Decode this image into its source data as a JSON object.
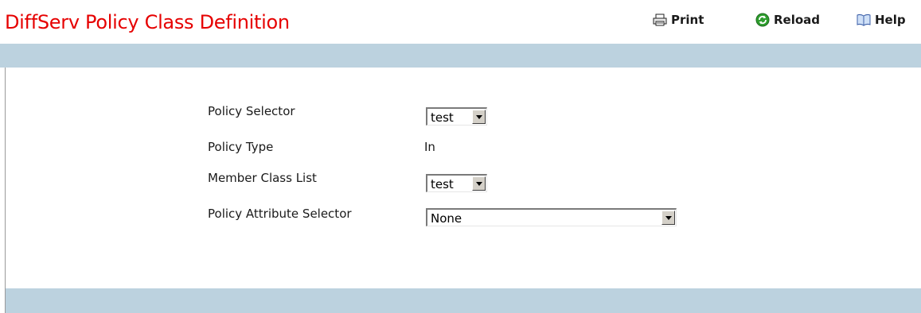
{
  "page": {
    "title": "DiffServ Policy Class Definition"
  },
  "toolbar": {
    "print_label": "Print",
    "reload_label": "Reload",
    "help_label": "Help"
  },
  "form": {
    "policy_selector": {
      "label": "Policy Selector",
      "value": "test"
    },
    "policy_type": {
      "label": "Policy Type",
      "value": "In"
    },
    "member_class_list": {
      "label": "Member Class List",
      "value": "test"
    },
    "policy_attribute_selector": {
      "label": "Policy Attribute Selector",
      "value": "None"
    }
  },
  "colors": {
    "title": "#e60000",
    "band": "#bcd2df",
    "reload_icon": "#2e9e2e",
    "help_icon": "#3c5fa8"
  },
  "icons": {
    "print": "printer-icon",
    "reload": "reload-icon",
    "help": "help-book-icon"
  }
}
